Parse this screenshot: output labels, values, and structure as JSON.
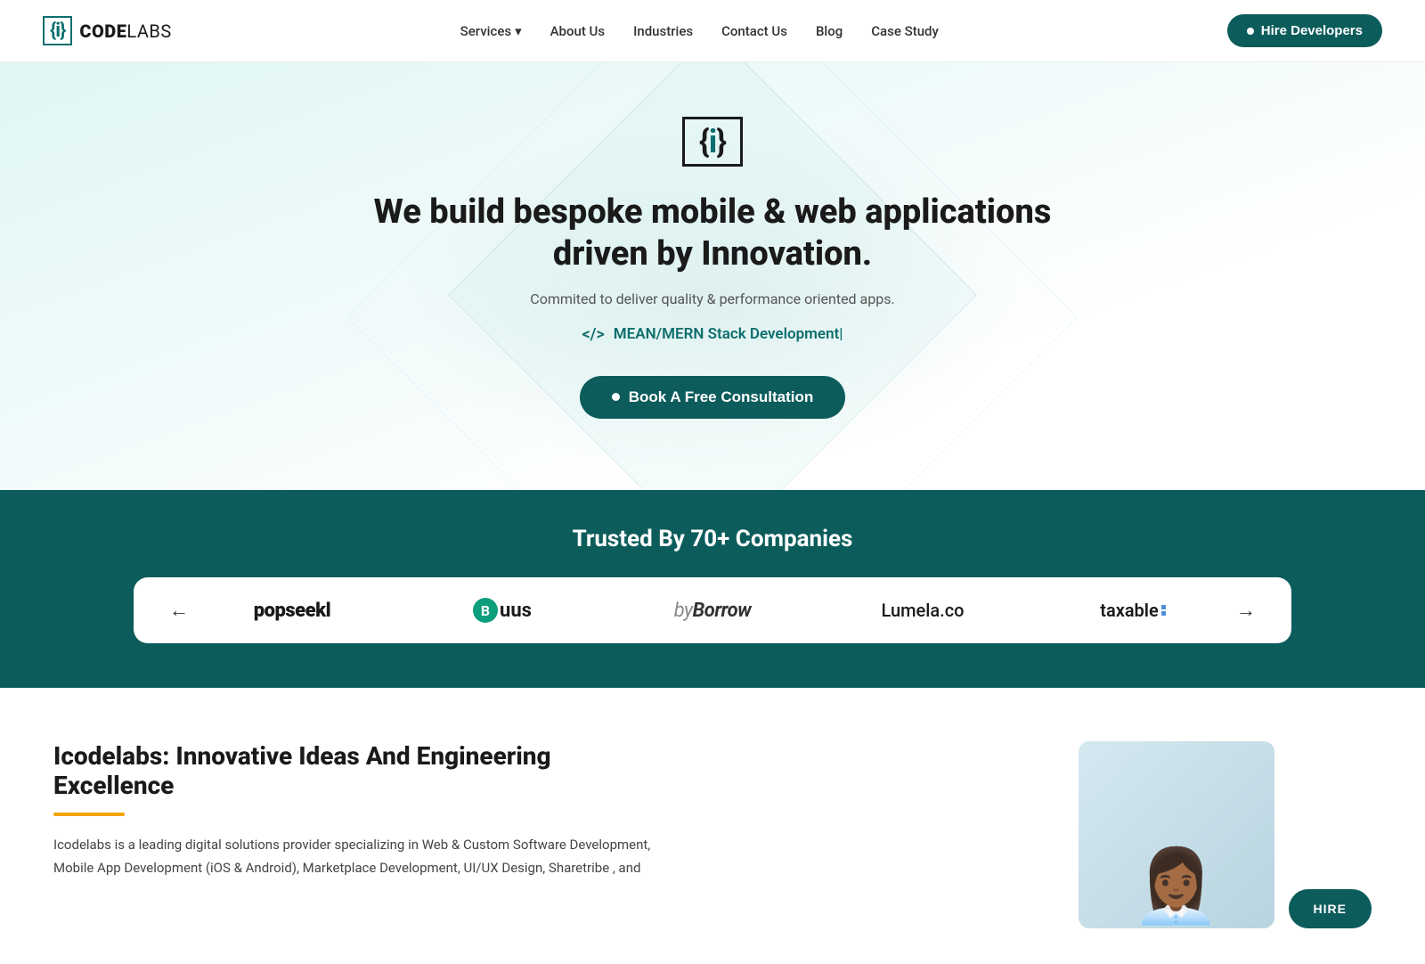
{
  "brand": {
    "logo_text_bold": "CODE",
    "logo_text_light": "LABS",
    "logo_symbol": "{i}"
  },
  "navbar": {
    "links": [
      {
        "label": "Services",
        "has_dropdown": true
      },
      {
        "label": "About Us",
        "has_dropdown": false
      },
      {
        "label": "Industries",
        "has_dropdown": false
      },
      {
        "label": "Contact Us",
        "has_dropdown": false
      },
      {
        "label": "Blog",
        "has_dropdown": false
      },
      {
        "label": "Case Study",
        "has_dropdown": false
      }
    ],
    "cta_label": "Hire Developers"
  },
  "hero": {
    "logo_symbol": "{i}",
    "title": "We build bespoke mobile & web applications driven by Innovation.",
    "subtitle": "Commited to deliver quality & performance oriented apps.",
    "typed_text": "MEAN/MERN Stack Development|",
    "cta_label": "Book A Free Consultation"
  },
  "trusted": {
    "heading": "Trusted By 70+ Companies",
    "logos": [
      {
        "name": "popseekl",
        "display": "popseekl"
      },
      {
        "name": "buus",
        "display": "Buus"
      },
      {
        "name": "byborrow",
        "display": "byBorrow"
      },
      {
        "name": "lumela",
        "display": "Lumela.co"
      },
      {
        "name": "taxable",
        "display": "taxable"
      }
    ]
  },
  "about": {
    "title": "Icodelabs: Innovative Ideas And Engineering Excellence",
    "body": "Icodelabs is a leading digital solutions provider specializing in Web & Custom Software Development, Mobile App Development (iOS & Android), Marketplace Development, UI/UX Design, Sharetribe , and",
    "hire_btn": "HIRE"
  }
}
